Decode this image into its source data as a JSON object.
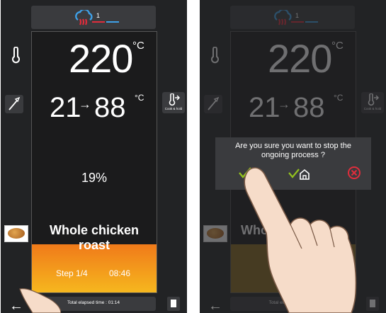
{
  "colors": {
    "screen_bg": "#222325",
    "accent_orange": "#f07a1a",
    "accent_yellow": "#f6b71e",
    "heat_red": "#e02d3c",
    "steam_blue": "#3fa1e8",
    "confirm_green": "#93c11f",
    "cancel_red": "#e02d3c"
  },
  "left_screen": {
    "mode_number": "1",
    "oven_temp": "220",
    "oven_temp_unit": "°C",
    "probe_current": "21",
    "probe_arrow": "→",
    "probe_target": "88",
    "probe_unit": "°C",
    "cook_hold_label": "Cook & hold",
    "progress": "19%",
    "recipe_line1": "Whole chicken",
    "recipe_line2": "roast",
    "step": "Step 1/4",
    "remaining_time": "08:46",
    "elapsed": "Total elapsed time : 01:14",
    "back_icon": "←"
  },
  "right_screen": {
    "mode_number": "1",
    "oven_temp": "220",
    "oven_temp_unit": "°C",
    "probe_current": "21",
    "probe_arrow": "→",
    "probe_target": "88",
    "probe_unit": "°C",
    "cook_hold_label": "Cook & hold",
    "recipe_partial": "Who",
    "elapsed": "Total elapsed time : 01:",
    "dialog_question": "Are you sure you want to stop the ongoing process ?",
    "back_icon": "←"
  }
}
